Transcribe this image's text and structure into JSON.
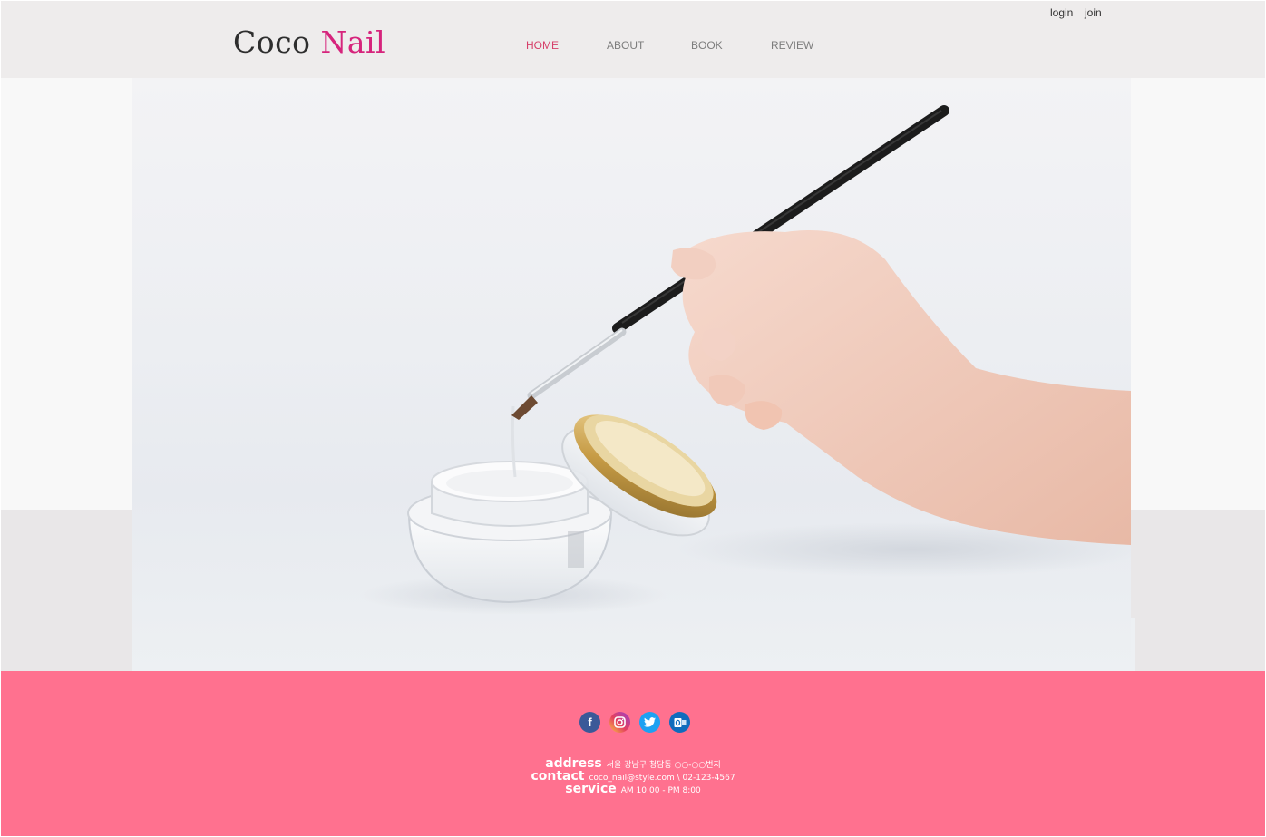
{
  "header": {
    "logo": {
      "part1": "Coco ",
      "part2": "Nail"
    },
    "nav": [
      {
        "label": "HOME",
        "active": true
      },
      {
        "label": "ABOUT"
      },
      {
        "label": "BOOK"
      },
      {
        "label": "REVIEW"
      }
    ],
    "auth": {
      "login": "login",
      "join": "join"
    }
  },
  "hero": {
    "image_subject": "hand holding nail brush over gel jar"
  },
  "footer": {
    "social": [
      "facebook-icon",
      "instagram-icon",
      "twitter-icon",
      "outlook-icon"
    ],
    "info": {
      "address_label": "address",
      "address_value": "서울 강남구 청담동 ○○-○○번지",
      "contact_label": "contact",
      "contact_value": "coco_nail@style.com \\ 02-123-4567",
      "service_label": "service",
      "service_value": "AM 10:00 - PM 8:00"
    }
  },
  "colors": {
    "header_bg": "#eeecec",
    "accent_pink": "#d6247c",
    "nav_active": "#d6406a",
    "footer_bg": "#ff718f"
  }
}
